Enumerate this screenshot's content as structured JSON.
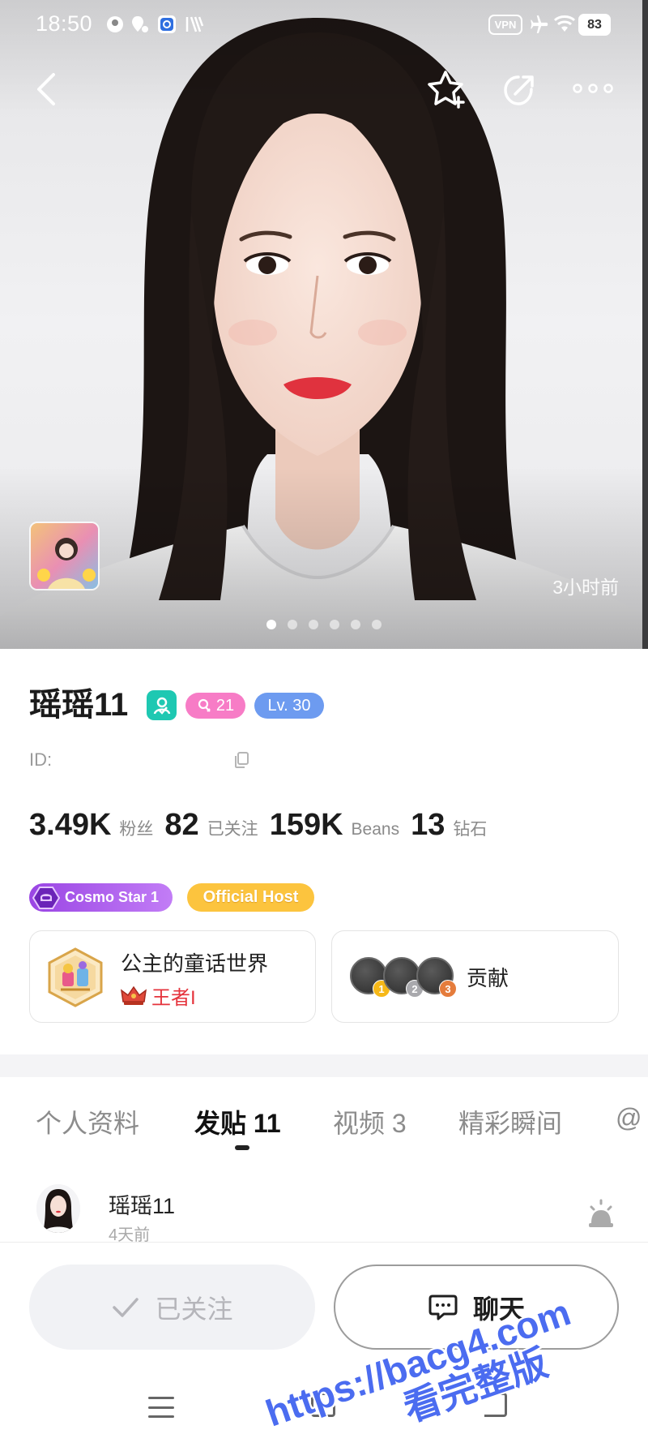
{
  "status_bar": {
    "time": "18:50",
    "vpn": "VPN",
    "battery": "83",
    "icons": [
      "face-icon",
      "location-icon",
      "app-icon",
      "stripes-icon",
      "airplane-icon",
      "wifi-icon",
      "battery-icon"
    ]
  },
  "header": {
    "icons": [
      "back-icon",
      "star-add-icon",
      "share-icon",
      "more-icon"
    ]
  },
  "hero": {
    "time_ago": "3小时前",
    "photo_count": 6,
    "active_photo": 0
  },
  "profile": {
    "name": "瑶瑶11",
    "fan_badge": "21",
    "level": "Lv. 30",
    "id_label": "ID:",
    "stats": [
      {
        "value": "3.49K",
        "label": "粉丝"
      },
      {
        "value": "82",
        "label": "已关注"
      },
      {
        "value": "159K",
        "label": "Beans"
      },
      {
        "value": "13",
        "label": "钻石"
      }
    ],
    "tags": [
      {
        "label": "Cosmo Star 1"
      },
      {
        "label": "Official Host"
      }
    ],
    "guild_card": {
      "title": "公主的童话世界",
      "rank": "王者I"
    },
    "contribution_card": {
      "label": "贡献",
      "medals": [
        "1",
        "2",
        "3"
      ]
    }
  },
  "tabs": [
    {
      "label": "个人资料"
    },
    {
      "label": "发贴 11",
      "active": true
    },
    {
      "label": "视频 3"
    },
    {
      "label": "精彩瞬间"
    },
    {
      "label": "@"
    }
  ],
  "post": {
    "author": "瑶瑶11",
    "time": "4天前"
  },
  "actions": {
    "follow": "已关注",
    "chat": "聊天"
  },
  "watermark": {
    "url": "https://bacg4.com",
    "text": "看完整版"
  },
  "colors": {
    "teal_badge": "#1ec8b2",
    "pink_badge": "#f77cc6",
    "level_badge": "#6d9bf0",
    "cosmo_tag": "#9a45e4",
    "host_tag": "#fcc43e",
    "rank_text": "#e5333c",
    "watermark": "#4b6cf0"
  }
}
